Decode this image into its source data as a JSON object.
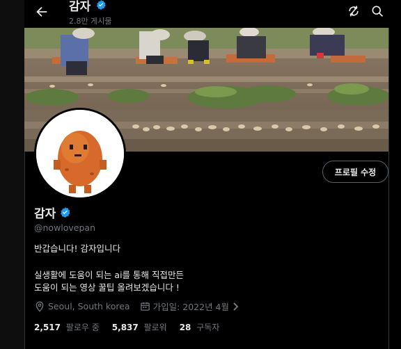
{
  "header": {
    "title": "감자",
    "subtitle": "2.8만 게시물"
  },
  "profile": {
    "name": "감자",
    "handle": "@nowlovepan",
    "edit_button": "프로필 수정",
    "bio_line1": "반갑습니다! 감자입니다",
    "bio_line2": "실생활에 도움이 되는 ai를 통해 직접만든",
    "bio_line3": "도움이 되는 영상 꿀팁 올려보겠습니다 !",
    "location": "Seoul, South korea",
    "joined": "가입일: 2022년 4월",
    "following_count": "2,517",
    "following_label": "팔로우 중",
    "followers_count": "5,837",
    "followers_label": "팔로워",
    "subscribers_count": "28",
    "subscribers_label": "구독자"
  },
  "colors": {
    "accent": "#1d9bf0",
    "text": "#e7e9ea",
    "muted": "#71767b",
    "background": "#000000"
  },
  "icons": {
    "back": "arrow-left-icon",
    "sync": "sync-icon",
    "search": "search-icon",
    "verified": "verified-badge-icon",
    "location": "location-pin-icon",
    "calendar": "calendar-icon",
    "chevron": "chevron-right-icon"
  }
}
